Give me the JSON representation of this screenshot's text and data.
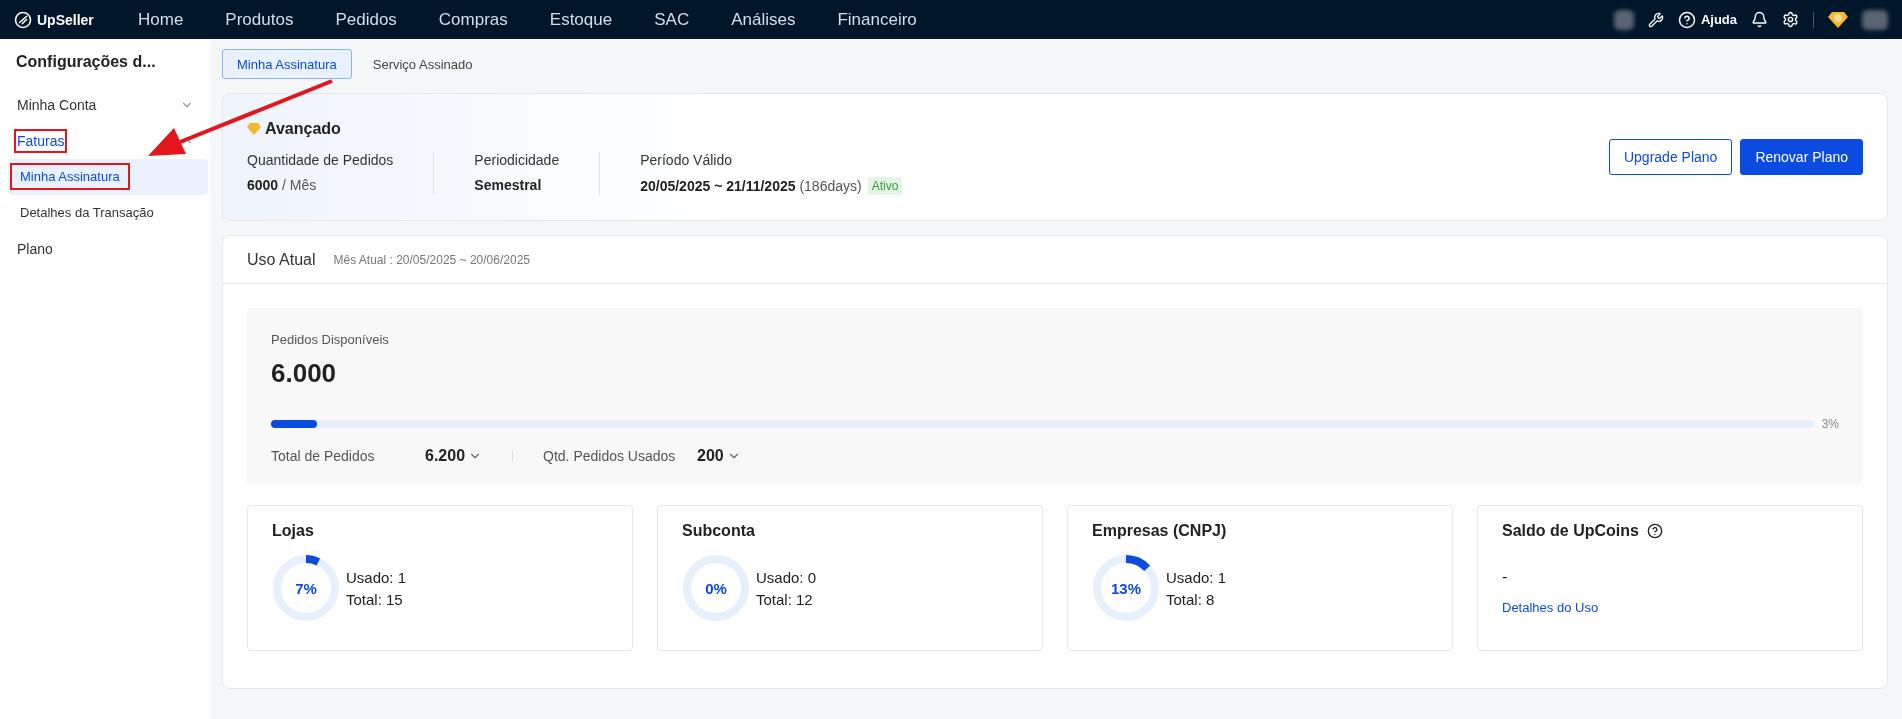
{
  "navbar": {
    "logo": "UpSeller",
    "menu": [
      {
        "label": "Home",
        "selected": false
      },
      {
        "label": "Produtos",
        "selected": false
      },
      {
        "label": "Pedidos",
        "selected": false
      },
      {
        "label": "Compras",
        "selected": false
      },
      {
        "label": "Estoque",
        "selected": false
      },
      {
        "label": "SAC",
        "selected": false
      },
      {
        "label": "Análises",
        "selected": false
      },
      {
        "label": "Financeiro",
        "selected": false
      }
    ],
    "help": "Ajuda"
  },
  "sidebar": {
    "title": "Configurações d...",
    "items": [
      {
        "label": "Minha Conta",
        "expanded": false,
        "annotated": false
      },
      {
        "label": "Faturas",
        "expanded": true,
        "annotated": true,
        "children": [
          {
            "label": "Minha Assinatura",
            "selected": true,
            "annotated": true
          },
          {
            "label": "Detalhes da Transação",
            "selected": false,
            "annotated": false
          }
        ]
      },
      {
        "label": "Plano",
        "annotated": false
      }
    ]
  },
  "tabs": [
    {
      "label": "Minha Assinatura",
      "selected": true
    },
    {
      "label": "Serviço Assinado",
      "selected": false
    }
  ],
  "plan": {
    "name": "Avançado",
    "fields": [
      {
        "label": "Quantidade de Pedidos",
        "value": "6000",
        "unit": " / Mês"
      },
      {
        "label": "Periodicidade",
        "value": "Semestral"
      },
      {
        "label": "Período Válido",
        "value": "20/05/2025 ~ 21/11/2025",
        "unit": " (186days)",
        "badge": "Ativo"
      }
    ],
    "buttons": [
      {
        "label": "Upgrade Plano",
        "kind": "outline"
      },
      {
        "label": "Renovar Plano",
        "kind": "primary"
      }
    ]
  },
  "usage": {
    "title": "Uso Atual",
    "period": "Mês Atual : 20/05/2025 ~ 20/06/2025",
    "available_label": "Pedidos Disponíveis",
    "available": "6.000",
    "level": 0.03,
    "percent": "3%",
    "totals": [
      {
        "label": "Total de Pedidos",
        "value": "6.200"
      },
      {
        "label": "Qtd. Pedidos Usados",
        "value": "200"
      }
    ],
    "cards": [
      {
        "kind": "donut",
        "title": "Lojas",
        "level": 0.07,
        "percent": "7%",
        "used": "Usado: 1",
        "total": "Total: 15"
      },
      {
        "kind": "donut",
        "title": "Subconta",
        "level": 0,
        "percent": "0%",
        "used": "Usado: 0",
        "total": "Total: 12"
      },
      {
        "kind": "donut",
        "title": "Empresas (CNPJ)",
        "level": 0.13,
        "percent": "13%",
        "used": "Usado: 1",
        "total": "Total: 8"
      },
      {
        "kind": "coins",
        "title": "Saldo de UpCoins",
        "value": "-",
        "link": "Detalhes do Uso"
      }
    ]
  },
  "annotation_arrow": true
}
